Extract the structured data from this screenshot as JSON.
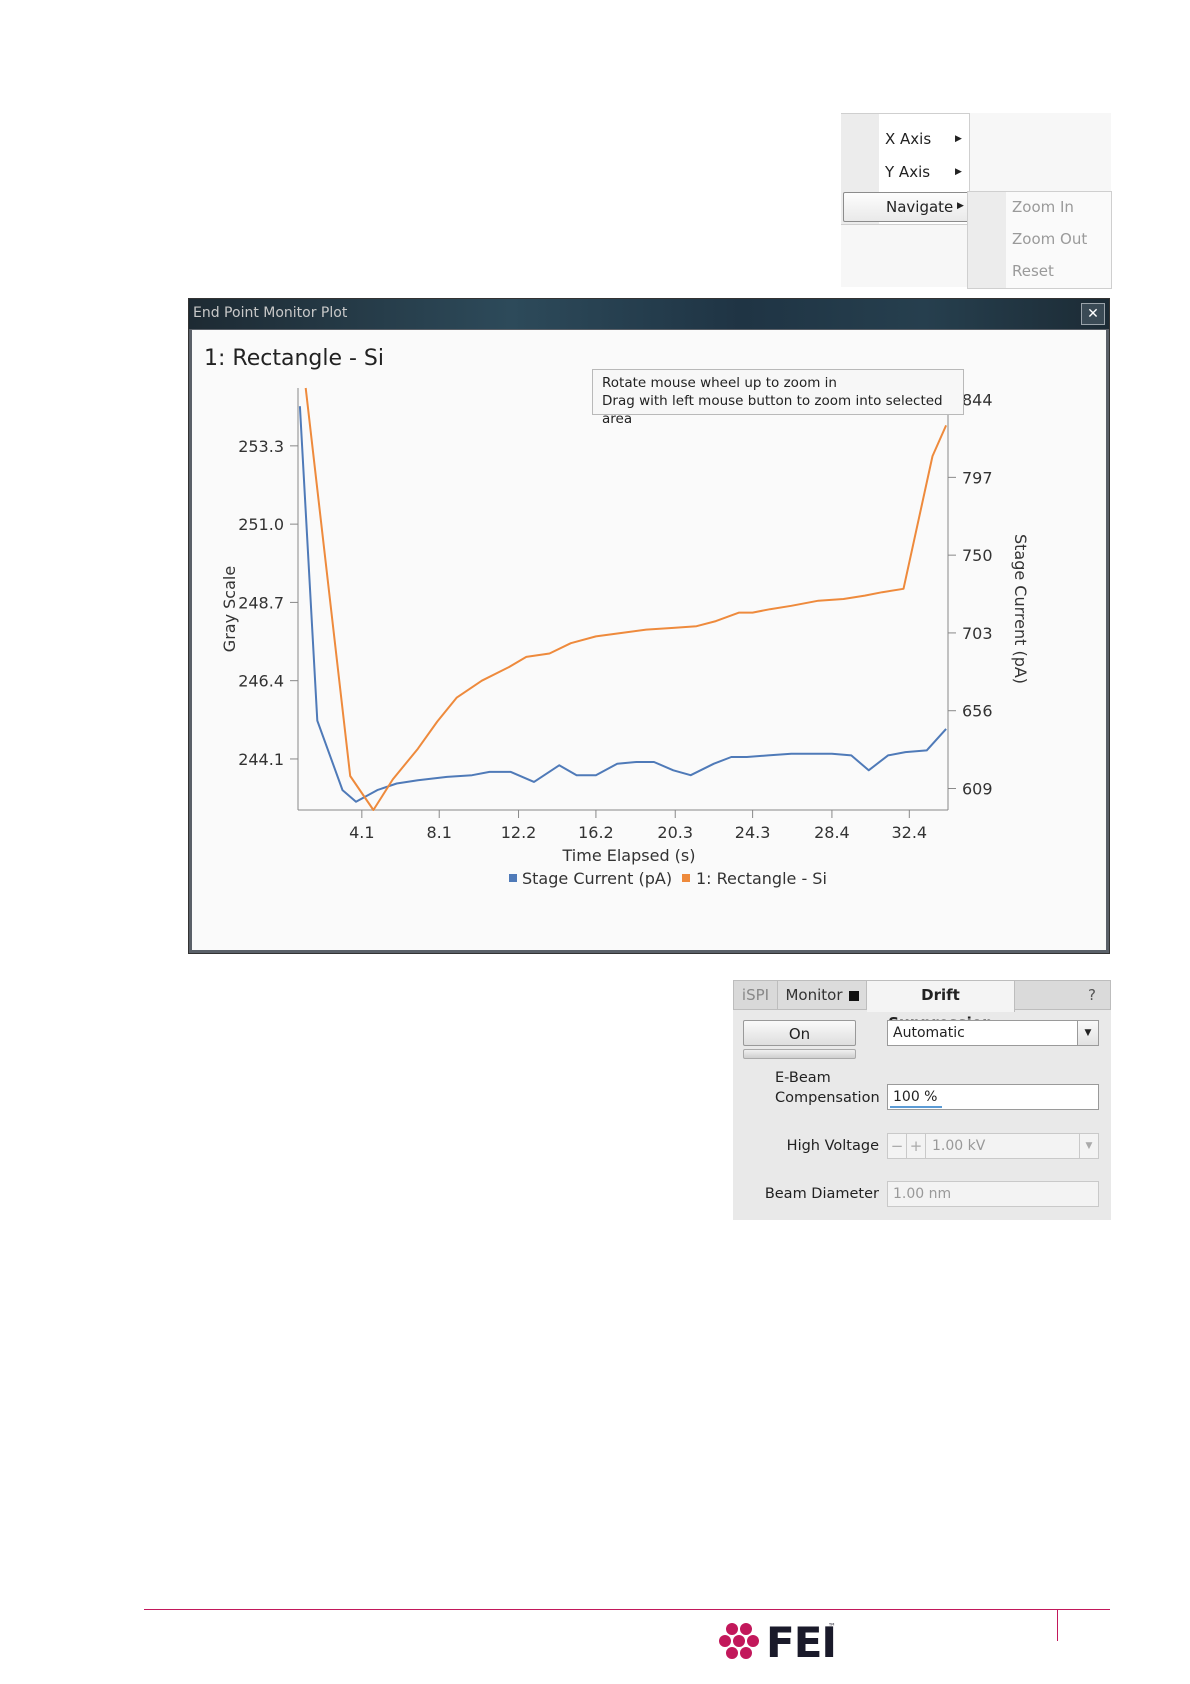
{
  "context_menu": {
    "items": [
      {
        "label": "X Axis"
      },
      {
        "label": "Y Axis"
      },
      {
        "label": "Navigate"
      }
    ],
    "submenu": [
      "Zoom In",
      "Zoom Out",
      "Reset"
    ]
  },
  "window": {
    "title": "End Point Monitor Plot",
    "close_glyph": "✕"
  },
  "plot": {
    "title": "1: Rectangle - Si",
    "tooltip_line1": "Rotate mouse wheel up to zoom in",
    "tooltip_line2": "Drag with left mouse button to zoom into selected area"
  },
  "chart_data": {
    "type": "line",
    "xlabel": "Time Elapsed (s)",
    "ylabel_left": "Gray Scale",
    "ylabel_right": "Stage Current (pA)",
    "x_ticks": [
      "4.1",
      "8.1",
      "12.2",
      "16.2",
      "20.3",
      "24.3",
      "28.4",
      "32.4"
    ],
    "y_left_ticks": [
      "253.3",
      "251.0",
      "248.7",
      "246.4",
      "244.1"
    ],
    "y_right_ticks": [
      "844",
      "797",
      "750",
      "703",
      "656",
      "609"
    ],
    "xlim": [
      0.8,
      34.4
    ],
    "ylim_left": [
      242.6,
      255.0
    ],
    "ylim_right": [
      596,
      851
    ],
    "series": [
      {
        "name": "Stage Current (pA)",
        "color": "#4f7ab8",
        "axis": "right",
        "x": [
          0.9,
          1.8,
          3.1,
          3.8,
          4.9,
          5.9,
          7.0,
          8.5,
          9.8,
          10.7,
          11.8,
          13.0,
          14.3,
          15.2,
          16.2,
          17.3,
          18.3,
          19.2,
          20.2,
          21.1,
          22.3,
          23.2,
          24.0,
          25.1,
          26.3,
          27.3,
          28.4,
          29.4,
          30.3,
          31.3,
          32.2,
          33.3,
          34.3
        ],
        "y": [
          840,
          650,
          608,
          601,
          608,
          612,
          614,
          616,
          617,
          619,
          619,
          613,
          623,
          617,
          617,
          624,
          625,
          625,
          620,
          617,
          624,
          628,
          628,
          629,
          630,
          630,
          630,
          629,
          620,
          629,
          631,
          632,
          645
        ]
      },
      {
        "name": "1: Rectangle - Si",
        "color": "#ee8a3c",
        "axis": "left",
        "x": [
          1.2,
          3.5,
          4.7,
          5.7,
          7.0,
          8.0,
          9.0,
          10.3,
          11.7,
          12.6,
          13.8,
          14.9,
          16.2,
          17.5,
          18.8,
          20.2,
          21.4,
          22.4,
          23.6,
          24.3,
          25.2,
          26.3,
          27.7,
          29.0,
          30.1,
          31.0,
          32.1,
          33.6,
          34.3
        ],
        "y": [
          255.0,
          243.6,
          242.6,
          243.5,
          244.4,
          245.2,
          245.9,
          246.4,
          246.8,
          247.1,
          247.2,
          247.5,
          247.7,
          247.8,
          247.9,
          247.95,
          248.0,
          248.15,
          248.4,
          248.4,
          248.5,
          248.6,
          248.75,
          248.8,
          248.9,
          249.0,
          249.1,
          253.0,
          253.9
        ]
      }
    ],
    "legend": "bottom-center",
    "grid": false
  },
  "panel": {
    "tabs": {
      "ispi": "iSPI",
      "monitor": "Monitor",
      "drift": "Drift Suppression",
      "help": "?"
    },
    "on_button": "On",
    "mode_select": "Automatic",
    "ebeam_label_1": "E-Beam",
    "ebeam_label_2": "Compensation",
    "ebeam_value": "100 %",
    "hv_label": "High Voltage",
    "hv_minus": "−",
    "hv_plus": "+",
    "hv_value": "1.00 kV",
    "bd_label": "Beam Diameter",
    "bd_value": "1.00 nm"
  },
  "footer": {
    "logo_text": "FEI",
    "logo_tm": "™"
  }
}
